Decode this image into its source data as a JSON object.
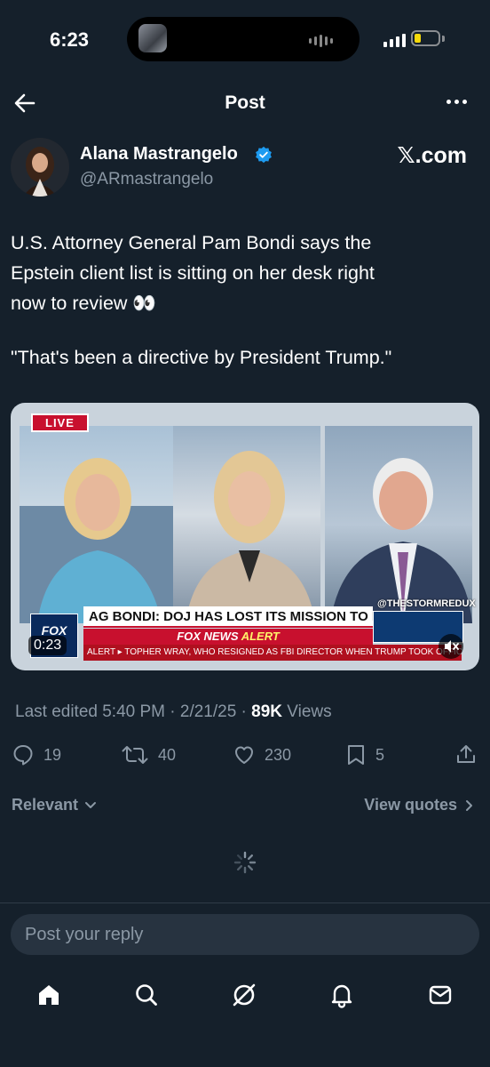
{
  "status_bar": {
    "time": "6:23"
  },
  "header": {
    "title": "Post"
  },
  "author": {
    "name": "Alana Mastrangelo",
    "handle": "@ARmastrangelo",
    "source": "𝕏.com"
  },
  "tweet": {
    "lines": [
      "U.S. Attorney General Pam Bondi says the",
      "Epstein client list is sitting on her desk right",
      "now to review 👀"
    ],
    "quote": "\"That's been a directive by President Trump.\""
  },
  "media": {
    "live_badge": "LIVE",
    "chyron": "AG BONDI: DOJ HAS LOST ITS MISSION TO FIGHT CRIME",
    "alert_brand": "FOX NEWS",
    "alert_word": "ALERT",
    "ticker": "ALERT ▸ TOPHER WRAY, WHO RESIGNED AS FBI DIRECTOR WHEN TRUMP TOOK OFFICE",
    "logo": "FOX",
    "watermark": "@THESTORMREDUX",
    "duration": "0:23"
  },
  "meta": {
    "edited": "Last edited 5:40 PM · 2/21/25 · ",
    "views_count": "89K",
    "views_label": " Views"
  },
  "actions": {
    "replies": "19",
    "reposts": "40",
    "likes": "230",
    "bookmarks": "5"
  },
  "sort": {
    "relevant": "Relevant",
    "view_quotes": "View quotes"
  },
  "reply": {
    "placeholder": "Post your reply"
  },
  "colors": {
    "background": "#15202b",
    "accent": "#1d9bf0",
    "muted": "#8b98a5"
  }
}
